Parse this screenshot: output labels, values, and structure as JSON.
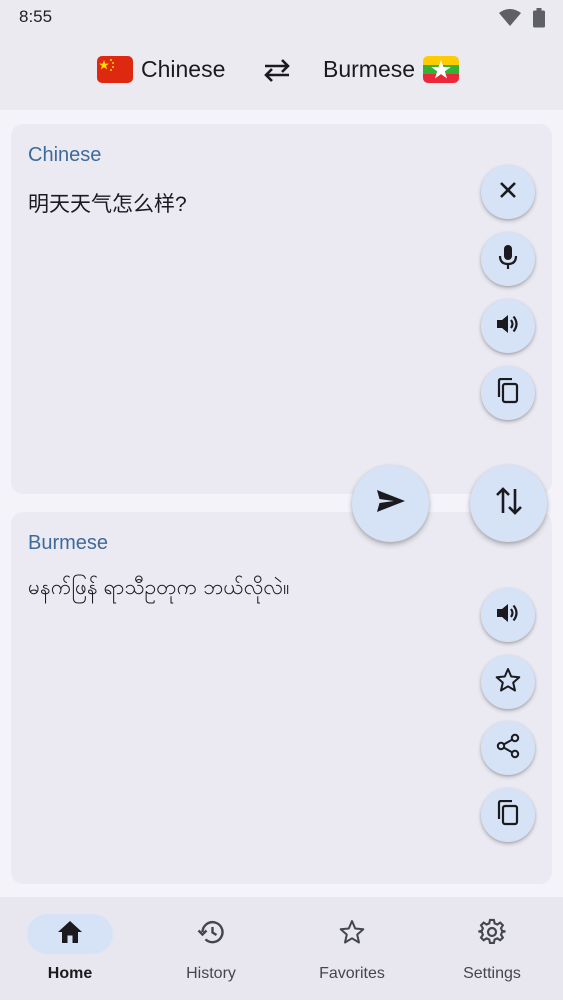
{
  "status_bar": {
    "time": "8:55",
    "icons": [
      "wifi-icon",
      "battery-icon"
    ]
  },
  "language_bar": {
    "source": {
      "name": "Chinese",
      "flag": "china-flag-icon"
    },
    "target": {
      "name": "Burmese",
      "flag": "myanmar-flag-icon"
    },
    "swap_icon": "swap-horizontal-icon"
  },
  "source_card": {
    "label": "Chinese",
    "text": "明天天气怎么样?",
    "actions": [
      "close-icon",
      "mic-icon",
      "volume-icon",
      "copy-icon"
    ]
  },
  "target_card": {
    "label": "Burmese",
    "text": "မနက်ဖြန် ရာသီဥတုက ဘယ်လိုလဲ။",
    "actions": [
      "volume-icon",
      "star-icon",
      "share-icon",
      "copy-icon"
    ]
  },
  "fabs": {
    "translate": "send-icon",
    "swap": "swap-vertical-icon"
  },
  "bottom_nav": {
    "items": [
      {
        "label": "Home",
        "icon": "home-icon",
        "active": true
      },
      {
        "label": "History",
        "icon": "history-icon",
        "active": false
      },
      {
        "label": "Favorites",
        "icon": "star-outline-icon",
        "active": false
      },
      {
        "label": "Settings",
        "icon": "gear-icon",
        "active": false
      }
    ]
  },
  "colors": {
    "accent": "#3e6a9a",
    "button_bg": "#d6e3f7",
    "card_bg": "#ebeaf2",
    "china_red": "#de2910",
    "china_yellow": "#ffde00",
    "myanmar_yellow": "#fecb00",
    "myanmar_green": "#34b233",
    "myanmar_red": "#ea2839"
  }
}
